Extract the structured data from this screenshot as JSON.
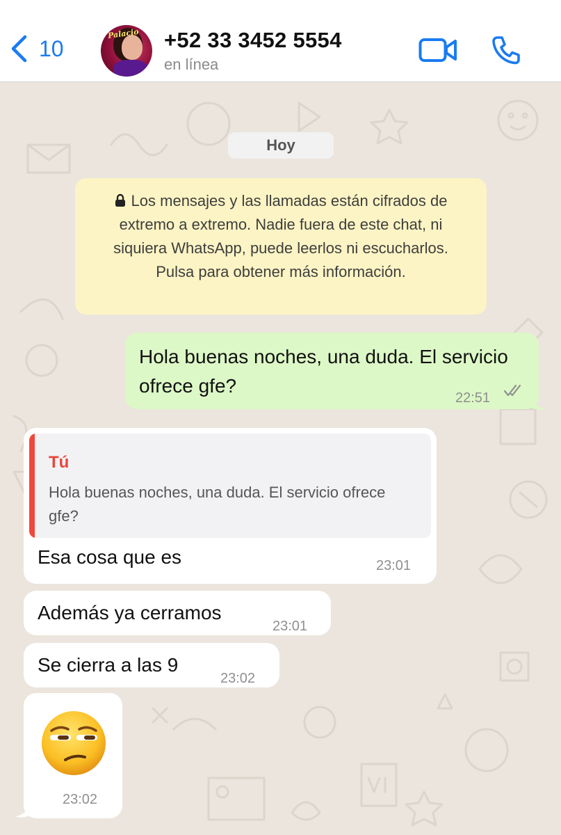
{
  "header": {
    "back_count": "10",
    "avatar_text": "Palacio",
    "contact_name": "+52 33 3452 5554",
    "status": "en línea",
    "icons": {
      "back": "chevron-left-icon",
      "video": "video-camera-icon",
      "call": "phone-icon"
    },
    "accent_color": "#1a7bf2"
  },
  "chat": {
    "day_label": "Hoy",
    "encryption_notice": "Los mensajes y las llamadas están cifrados de extremo a extremo. Nadie fuera de este chat, ni siquiera WhatsApp, puede leerlos ni escucharlos. Pulsa para obtener más información.",
    "messages": [
      {
        "direction": "out",
        "text": "Hola buenas noches, una duda. El servicio ofrece gfe?",
        "time": "22:51",
        "status": "read"
      },
      {
        "direction": "in",
        "reply_to": {
          "author": "Tú",
          "text": "Hola buenas noches, una duda. El servicio ofrece gfe?"
        },
        "text": "Esa cosa que es",
        "time": "23:01"
      },
      {
        "direction": "in",
        "text": "Además ya cerramos",
        "time": "23:01"
      },
      {
        "direction": "in",
        "text": "Se cierra a las 9",
        "time": "23:02"
      },
      {
        "direction": "in",
        "emoji": "unamused-face",
        "time": "23:02"
      }
    ],
    "colors": {
      "outgoing_bubble": "#dcf8c6",
      "incoming_bubble": "#ffffff",
      "notice_bg": "#fcf4c4",
      "reply_accent": "#e8453c"
    }
  }
}
